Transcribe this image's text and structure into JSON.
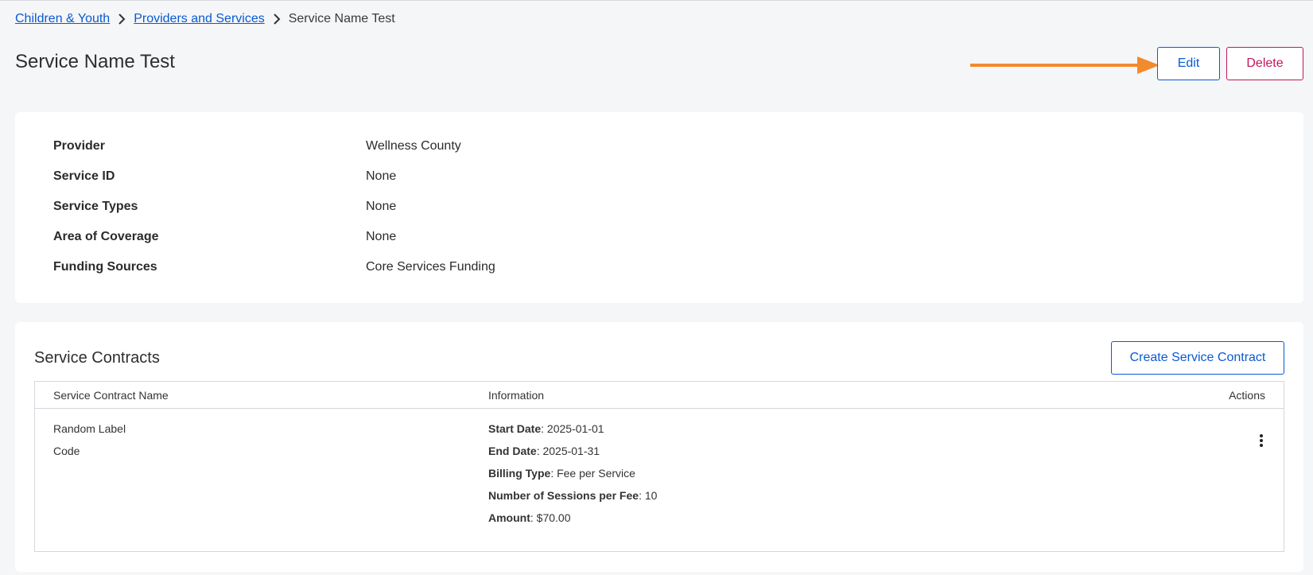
{
  "breadcrumb": {
    "items": [
      "Children & Youth",
      "Providers and Services"
    ],
    "current": "Service Name Test"
  },
  "page": {
    "title": "Service Name Test",
    "edit_label": "Edit",
    "delete_label": "Delete"
  },
  "details": [
    {
      "label": "Provider",
      "value": "Wellness County"
    },
    {
      "label": "Service ID",
      "value": "None"
    },
    {
      "label": "Service Types",
      "value": "None"
    },
    {
      "label": "Area of Coverage",
      "value": "None"
    },
    {
      "label": "Funding Sources",
      "value": "Core Services Funding"
    }
  ],
  "contracts": {
    "title": "Service Contracts",
    "create_label": "Create Service Contract",
    "columns": [
      "Service Contract Name",
      "Information",
      "Actions"
    ],
    "rows": [
      {
        "name_lines": [
          "Random Label",
          "Code"
        ],
        "info": [
          {
            "label": "Start Date",
            "value": ": 2025-01-01"
          },
          {
            "label": "End Date",
            "value": ": 2025-01-31"
          },
          {
            "label": "Billing Type",
            "value": ": Fee per Service"
          },
          {
            "label": "Number of Sessions per Fee",
            "value": ": 10"
          },
          {
            "label": "Amount",
            "value": ": $70.00"
          }
        ]
      }
    ]
  },
  "colors": {
    "accent": "#0a5ad1",
    "danger": "#c0185a",
    "annotation_arrow": "#f28a2e"
  },
  "icons": [
    "chevron-right-icon",
    "annotation-arrow",
    "more-vertical-icon"
  ]
}
